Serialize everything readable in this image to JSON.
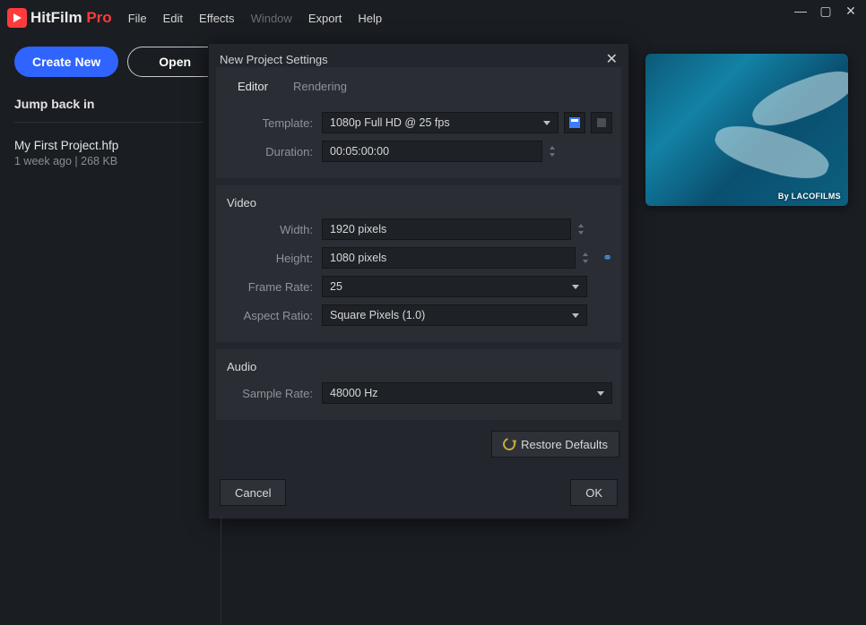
{
  "app": {
    "logo_name": "HitFilm",
    "logo_suffix": "Pro"
  },
  "menu": {
    "file": "File",
    "edit": "Edit",
    "effects": "Effects",
    "window": "Window",
    "export": "Export",
    "help": "Help"
  },
  "home": {
    "create_btn": "Create New",
    "open_btn": "Open",
    "jump_title": "Jump back in",
    "project_name": "My First Project.hfp",
    "project_meta": "1 week ago | 268 KB",
    "thumb_credit": "By LACOFILMS"
  },
  "dialog": {
    "title": "New Project Settings",
    "tabs": {
      "editor": "Editor",
      "rendering": "Rendering"
    },
    "labels": {
      "template": "Template:",
      "duration": "Duration:",
      "width": "Width:",
      "height": "Height:",
      "frame_rate": "Frame Rate:",
      "aspect_ratio": "Aspect Ratio:",
      "sample_rate": "Sample Rate:"
    },
    "sections": {
      "video": "Video",
      "audio": "Audio"
    },
    "values": {
      "template": "1080p Full HD @ 25 fps",
      "duration": "00:05:00:00",
      "width": "1920 pixels",
      "height": "1080 pixels",
      "frame_rate": "25",
      "aspect_ratio": "Square Pixels (1.0)",
      "sample_rate": "48000 Hz"
    },
    "restore_btn": "Restore Defaults",
    "cancel_btn": "Cancel",
    "ok_btn": "OK"
  },
  "colors": {
    "accent": "#2f64ff",
    "brand_red": "#ff3b3b"
  }
}
